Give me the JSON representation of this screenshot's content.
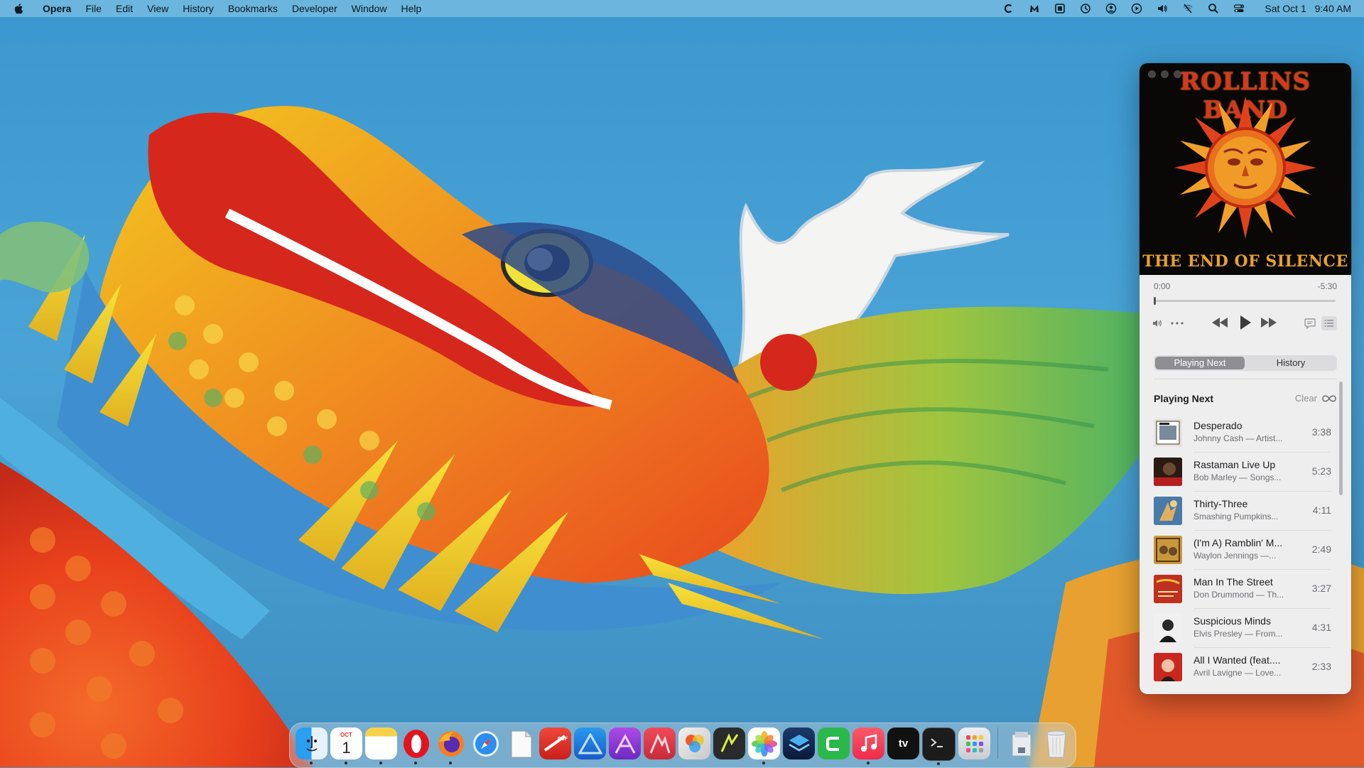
{
  "menubar": {
    "app_name": "Opera",
    "menus": [
      "File",
      "Edit",
      "View",
      "History",
      "Bookmarks",
      "Developer",
      "Window",
      "Help"
    ],
    "status_icons": [
      "c-icon",
      "malwarebytes-icon",
      "cpu-icon",
      "time-machine-icon",
      "user-icon",
      "play-circle-icon",
      "volume-icon",
      "wifi-off-icon",
      "search-icon",
      "control-center-icon"
    ],
    "date": "Sat Oct 1",
    "time": "9:40 AM"
  },
  "player": {
    "album_art": {
      "artist_text": "ROLLINS BAND",
      "album_text": "THE END OF SILENCE"
    },
    "elapsed": "0:00",
    "remaining": "-5:30",
    "progress": 0.0,
    "controls": [
      "volume-icon",
      "more-icon",
      "rewind-icon",
      "play-icon",
      "fast-forward-icon",
      "lyrics-icon",
      "queue-icon"
    ],
    "tabs": {
      "playing_next": "Playing Next",
      "history": "History",
      "active": "Playing Next"
    },
    "queue_header": {
      "title": "Playing Next",
      "clear": "Clear"
    },
    "queue": [
      {
        "title": "Desperado",
        "subtitle": "Johnny Cash — Artist...",
        "duration": "3:38"
      },
      {
        "title": "Rastaman Live Up",
        "subtitle": "Bob Marley — Songs...",
        "duration": "5:23"
      },
      {
        "title": "Thirty-Three",
        "subtitle": "Smashing Pumpkins...",
        "duration": "4:11"
      },
      {
        "title": "(I'm A) Ramblin' M...",
        "subtitle": "Waylon Jennings —...",
        "duration": "2:49"
      },
      {
        "title": "Man In The Street",
        "subtitle": "Don Drummond — Th...",
        "duration": "3:27"
      },
      {
        "title": "Suspicious Minds",
        "subtitle": "Elvis Presley — From...",
        "duration": "4:31"
      },
      {
        "title": "All I Wanted (feat....",
        "subtitle": "Avril Lavigne — Love...",
        "duration": "2:33"
      }
    ]
  },
  "dock": {
    "apps": [
      {
        "name": "Finder",
        "icon": "finder-icon",
        "running": true
      },
      {
        "name": "Calendar",
        "icon": "calendar-icon",
        "running": true,
        "month": "OCT",
        "day": "1"
      },
      {
        "name": "Notes",
        "icon": "notes-icon",
        "running": true
      },
      {
        "name": "Opera",
        "icon": "opera-icon",
        "running": true
      },
      {
        "name": "Firefox",
        "icon": "firefox-icon",
        "running": true
      },
      {
        "name": "Safari",
        "icon": "safari-icon",
        "running": false
      },
      {
        "name": "TextEdit",
        "icon": "textedit-icon",
        "running": false
      },
      {
        "name": "PDF Expert",
        "icon": "pdf-icon",
        "running": false
      },
      {
        "name": "Affinity Designer",
        "icon": "affinity-designer-icon",
        "running": false
      },
      {
        "name": "Affinity Photo",
        "icon": "affinity-photo-icon",
        "running": false
      },
      {
        "name": "Affinity Publisher",
        "icon": "affinity-publisher-icon",
        "running": false
      },
      {
        "name": "Pixelmator",
        "icon": "pixelmator-icon",
        "running": false
      },
      {
        "name": "Vectorize",
        "icon": "vector-icon",
        "running": false
      },
      {
        "name": "Photos",
        "icon": "photos-icon",
        "running": true
      },
      {
        "name": "Layers",
        "icon": "layers-icon",
        "running": false
      },
      {
        "name": "Cursor",
        "icon": "c-app-icon",
        "running": false
      },
      {
        "name": "Music",
        "icon": "music-icon",
        "running": true
      },
      {
        "name": "TV",
        "icon": "tv-icon",
        "running": false
      },
      {
        "name": "Terminal",
        "icon": "terminal-icon",
        "running": true
      },
      {
        "name": "Launchpad",
        "icon": "launchpad-icon",
        "running": false
      },
      {
        "name": "Downloads",
        "icon": "downloads-icon",
        "running": false
      },
      {
        "name": "Trash",
        "icon": "trash-icon",
        "running": false
      }
    ],
    "tv_label": "tv"
  },
  "colors": {
    "accent_tab": "#8e8e93",
    "sky": "#3f9bd0"
  }
}
